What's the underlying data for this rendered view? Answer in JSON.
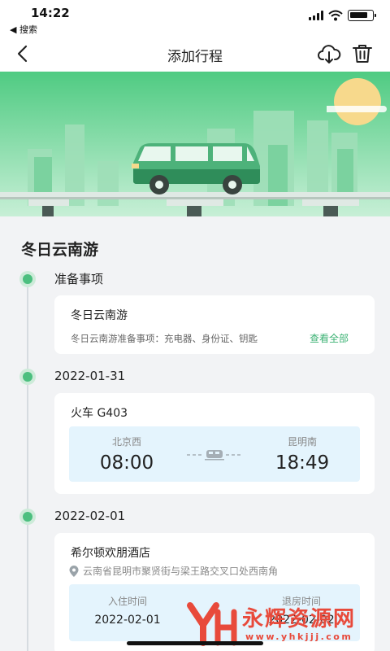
{
  "status_bar": {
    "time": "14:22",
    "back_label": "◀ 搜索",
    "battery_level": 0.85
  },
  "nav": {
    "title": "添加行程",
    "icons": [
      "back-chevron-icon",
      "cloud-download-icon",
      "trash-icon"
    ]
  },
  "trip": {
    "title": "冬日云南游"
  },
  "prep": {
    "section_label": "准备事项",
    "card_title": "冬日云南游",
    "description": "冬日云南游准备事项：充电器、身份证、钥匙",
    "link_label": "查看全部"
  },
  "day1": {
    "date": "2022-01-31",
    "train": {
      "title": "火车 G403",
      "from_station": "北京西",
      "depart_time": "08:00",
      "to_station": "昆明南",
      "arrive_time": "18:49"
    }
  },
  "day2": {
    "date": "2022-02-01",
    "hotel": {
      "name": "希尔顿欢朋酒店",
      "address": "云南省昆明市聚贤街与梁王路交叉口处西南角",
      "checkin_label": "入住时间",
      "checkin_date": "2022-02-01",
      "checkout_label": "退房时间",
      "checkout_date": "2022-02-02"
    }
  },
  "watermark": {
    "logo_text": "YH",
    "text": "永辉资源网",
    "url": "www.yhkjjj.com"
  },
  "colors": {
    "accent_green": "#4cbf7f",
    "link_green": "#3bb273",
    "info_blue": "#e4f4fd",
    "watermark_red": "#e84a3b"
  }
}
